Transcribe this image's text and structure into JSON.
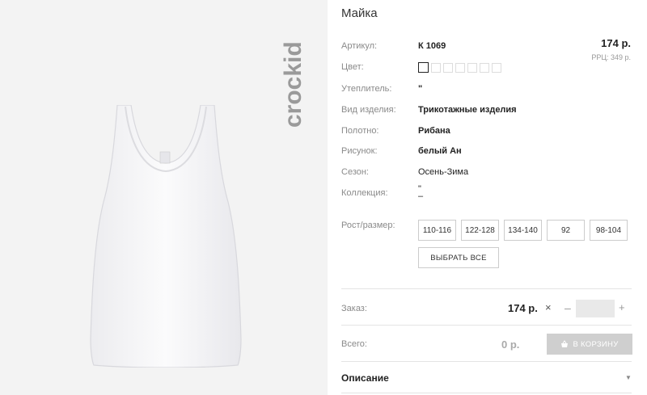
{
  "brand": {
    "logo_text": "crockid"
  },
  "product": {
    "title": "Майка",
    "price": "174 р.",
    "rrp": "РРЦ: 349 р.",
    "specs": [
      {
        "label": "Артикул:",
        "value": "К 1069",
        "bold": true
      },
      {
        "label": "Цвет:",
        "value": ""
      },
      {
        "label": "Утеплитель:",
        "value": "\"",
        "bold": true
      },
      {
        "label": "Вид изделия:",
        "value": "Трикотажные изделия",
        "bold": true
      },
      {
        "label": "Полотно:",
        "value": "Рибана",
        "bold": true
      },
      {
        "label": "Рисунок:",
        "value": "белый Ан",
        "bold": true
      },
      {
        "label": "Сезон:",
        "value": "Осень-Зима",
        "bold": false
      },
      {
        "label": "Коллекция:",
        "value": "\"",
        "bold": false
      }
    ],
    "color_swatch_count": 7
  },
  "sizes": {
    "label": "Рост/размер:",
    "options": [
      "110-116",
      "122-128",
      "134-140",
      "92",
      "98-104"
    ],
    "select_all_label": "ВЫБРАТЬ ВСЕ"
  },
  "order": {
    "label": "Заказ:",
    "price": "174 р.",
    "times_symbol": "×",
    "minus_symbol": "–",
    "plus_symbol": "+",
    "quantity": ""
  },
  "total": {
    "label": "Всего:",
    "value": "0 р.",
    "cart_button_label": "В КОРЗИНУ",
    "cart_icon": "basket-icon"
  },
  "description": {
    "title": "Описание",
    "toggle_icon": "triangle-down-icon"
  },
  "colors": {
    "accent_dark": "#222222",
    "panel_bg": "#f3f3f3",
    "cart_disabled": "#cfcfcf"
  }
}
